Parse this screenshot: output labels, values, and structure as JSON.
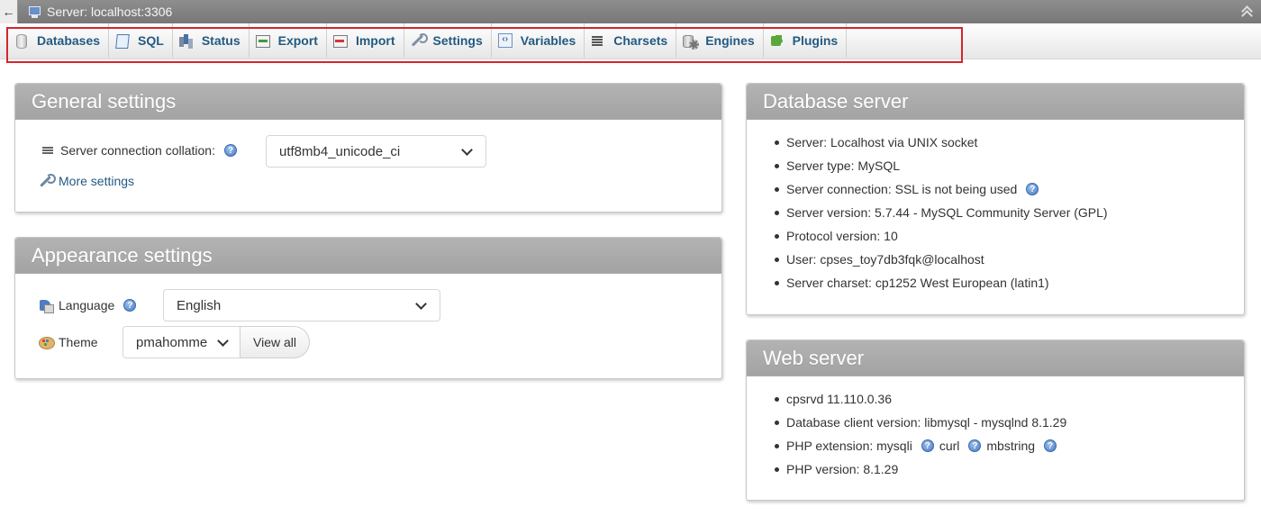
{
  "topbar": {
    "back_glyph": "←",
    "breadcrumb": "Server: localhost:3306"
  },
  "tabs": [
    {
      "label": "Databases",
      "icon": "database-icon"
    },
    {
      "label": "SQL",
      "icon": "sql-icon"
    },
    {
      "label": "Status",
      "icon": "status-icon"
    },
    {
      "label": "Export",
      "icon": "export-icon"
    },
    {
      "label": "Import",
      "icon": "import-icon"
    },
    {
      "label": "Settings",
      "icon": "wrench-icon"
    },
    {
      "label": "Variables",
      "icon": "variables-icon"
    },
    {
      "label": "Charsets",
      "icon": "charsets-icon"
    },
    {
      "label": "Engines",
      "icon": "engines-icon"
    },
    {
      "label": "Plugins",
      "icon": "plugin-icon"
    }
  ],
  "general_settings": {
    "title": "General settings",
    "collation_label": "Server connection collation:",
    "collation_value": "utf8mb4_unicode_ci",
    "more_settings": "More settings"
  },
  "appearance_settings": {
    "title": "Appearance settings",
    "language_label": "Language",
    "language_value": "English",
    "theme_label": "Theme",
    "theme_value": "pmahomme",
    "view_all": "View all"
  },
  "database_server": {
    "title": "Database server",
    "items": [
      "Server: Localhost via UNIX socket",
      "Server type: MySQL",
      "Server connection: SSL is not being used",
      "Server version: 5.7.44 - MySQL Community Server (GPL)",
      "Protocol version: 10",
      "User: cpses_toy7db3fqk@localhost",
      "Server charset: cp1252 West European (latin1)"
    ]
  },
  "web_server": {
    "title": "Web server",
    "items": [
      "cpsrvd 11.110.0.36",
      "Database client version: libmysql - mysqlnd 8.1.29"
    ],
    "php_extension_label": "PHP extension: mysqli",
    "php_ext_curl": "curl",
    "php_ext_mbstring": "mbstring",
    "php_version": "PHP version: 8.1.29"
  },
  "help_glyph": "?",
  "colors": {
    "tab_text": "#235a81",
    "highlight_border": "#d2262e",
    "panel_header": "#a8a8a8"
  }
}
